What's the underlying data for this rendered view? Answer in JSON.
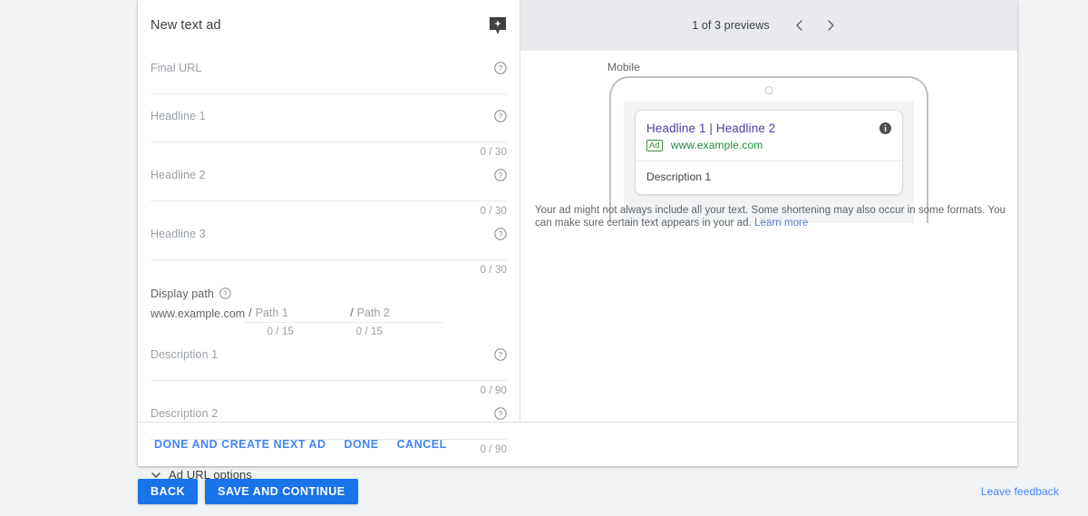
{
  "form": {
    "title": "New text ad",
    "sparkle_icon": "ad-suggestion-icon",
    "fields": [
      {
        "label": "Final URL",
        "counter": "",
        "help": "help-icon"
      },
      {
        "label": "Headline 1",
        "counter": "0 / 30",
        "help": "help-icon"
      },
      {
        "label": "Headline 2",
        "counter": "0 / 30",
        "help": "help-icon"
      },
      {
        "label": "Headline 3",
        "counter": "0 / 30",
        "help": "help-icon"
      }
    ],
    "display_path": {
      "title": "Display path",
      "domain": "www.example.com",
      "slash": "/",
      "path1_placeholder": "Path 1",
      "path2_placeholder": "Path 2",
      "path1_counter": "0 / 15",
      "path2_counter": "0 / 15"
    },
    "descriptions": [
      {
        "label": "Description 1",
        "counter": "0 / 90",
        "help": "help-icon"
      },
      {
        "label": "Description 2",
        "counter": "0 / 90",
        "help": "help-icon"
      }
    ],
    "ad_url_options": "Ad URL options",
    "actions": [
      {
        "label": "DONE AND CREATE NEXT AD"
      },
      {
        "label": "DONE"
      },
      {
        "label": "CANCEL"
      }
    ]
  },
  "preview": {
    "count_text": "1 of 3 previews",
    "prev_arrow": "chevron-left-icon",
    "next_arrow": "chevron-right-icon",
    "device_label": "Mobile",
    "ad": {
      "headline": "Headline 1 | Headline 2",
      "badge": "Ad",
      "url": "www.example.com",
      "description": "Description 1",
      "info_icon": "info-icon"
    },
    "disclaimer": "Your ad might not always include all your text. Some shortening may also occur in some formats. You can make sure certain text appears in your ad.",
    "learn_more": "Learn more"
  },
  "bottom_bar": {
    "back": "BACK",
    "save": "SAVE AND CONTINUE",
    "feedback": "Leave feedback"
  },
  "colors": {
    "accent": "#1a73e8",
    "link": "#4285f4",
    "ad_headline": "#4e3fa8",
    "ad_url": "#1e8e3e",
    "page_bg": "#f1f3f4",
    "preview_header_bg": "#e8eaed"
  }
}
